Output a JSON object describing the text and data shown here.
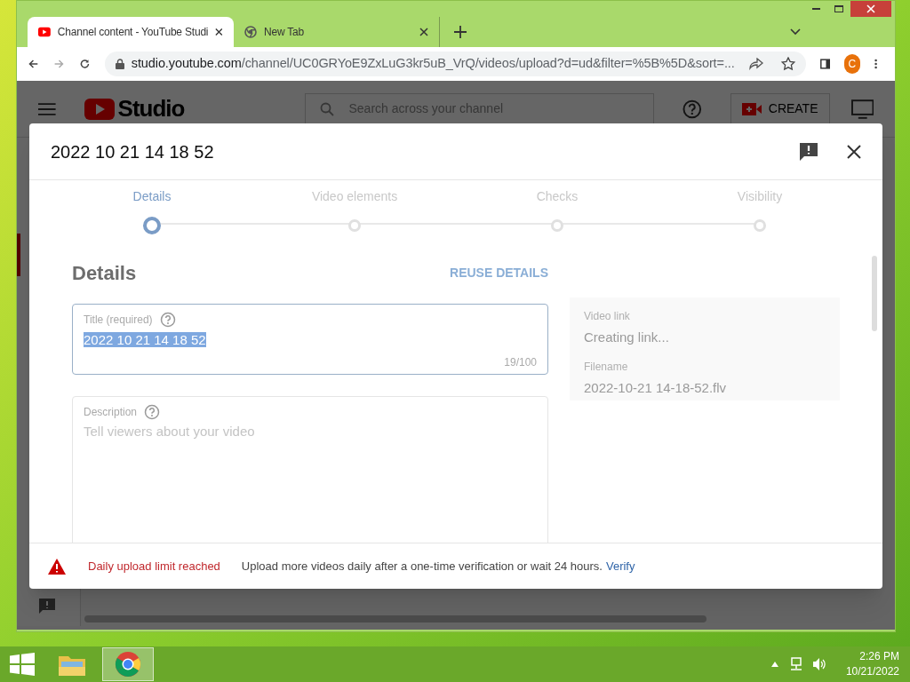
{
  "browser": {
    "tabs": [
      {
        "title": "Channel content - YouTube Studi",
        "selected": true,
        "kind": "youtube"
      },
      {
        "title": "New Tab",
        "selected": false,
        "kind": "chrome"
      }
    ],
    "url_host": "studio.youtube.com",
    "url_path": "/channel/UC0GRYoE9ZxLuG3kr5uB_VrQ/videos/upload?d=ud&filter=%5B%5D&sort=...",
    "profile_initial": "C"
  },
  "studio_header": {
    "logo": "Studio",
    "search_placeholder": "Search across your channel",
    "create_label": "CREATE"
  },
  "dialog": {
    "title": "2022 10 21 14 18 52",
    "steps": [
      {
        "label": "Details",
        "selected": true
      },
      {
        "label": "Video elements",
        "selected": false
      },
      {
        "label": "Checks",
        "selected": false
      },
      {
        "label": "Visibility",
        "selected": false
      }
    ],
    "section_title": "Details",
    "reuse_label": "REUSE DETAILS",
    "title_field": {
      "label": "Title (required)",
      "value": "2022 10 21 14 18 52",
      "value_selected": true,
      "counter": "19/100"
    },
    "description_field": {
      "label": "Description",
      "placeholder": "Tell viewers about your video"
    },
    "info": [
      {
        "label": "Video link",
        "value": "Creating link..."
      },
      {
        "label": "Filename",
        "value": "2022-10-21 14-18-52.flv"
      }
    ],
    "footer": {
      "warning": "Daily upload limit reached",
      "message": "Upload more videos daily after a one-time verification or wait 24 hours.",
      "link": "Verify"
    }
  },
  "taskbar": {
    "time": "2:26 PM",
    "date": "10/21/2022"
  }
}
